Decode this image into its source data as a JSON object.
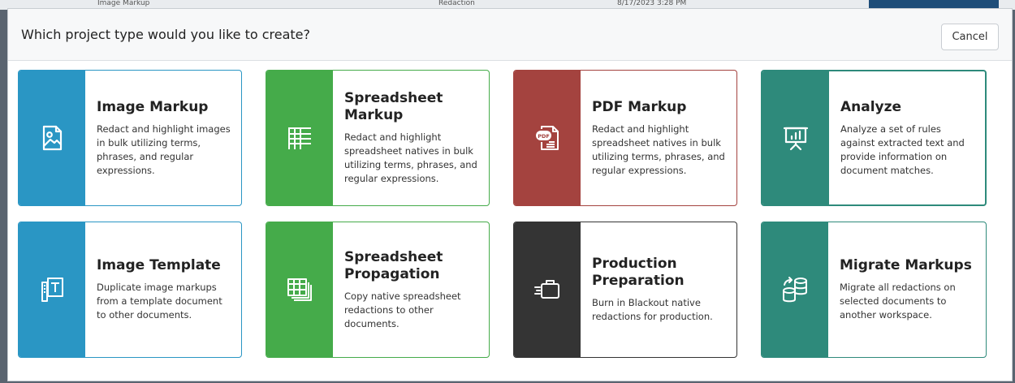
{
  "background": {
    "row_text_1": "Image Markup",
    "row_text_2": "Redaction",
    "row_text_3": "8/17/2023 3:28 PM"
  },
  "modal": {
    "title": "Which project type would you like to create?",
    "cancel_label": "Cancel"
  },
  "cards": [
    {
      "title": "Image Markup",
      "description": "Redact and highlight images in bulk utilizing terms, phrases, and regular expressions.",
      "icon": "image-icon",
      "color": "#2a96c4"
    },
    {
      "title": "Spreadsheet Markup",
      "description": "Redact and highlight spreadsheet natives in bulk utilizing terms, phrases, and regular expressions.",
      "icon": "spreadsheet-icon",
      "color": "#45ab4a"
    },
    {
      "title": "PDF Markup",
      "description": "Redact and highlight spreadsheet natives in bulk utilizing terms, phrases, and regular expressions.",
      "icon": "pdf-icon",
      "color": "#a4433f"
    },
    {
      "title": "Analyze",
      "description": "Analyze a set of rules against extracted text and provide information on document matches.",
      "icon": "presentation-chart-icon",
      "color": "#2e8a7b",
      "selected": true
    },
    {
      "title": "Image Template",
      "description": "Duplicate image markups from a template document to other documents.",
      "icon": "template-icon",
      "color": "#2a96c4"
    },
    {
      "title": "Spreadsheet Propagation",
      "description": "Copy native spreadsheet redactions to other documents.",
      "icon": "spreadsheet-stack-icon",
      "color": "#45ab4a"
    },
    {
      "title": "Production Preparation",
      "description": "Burn in Blackout native redactions for production.",
      "icon": "briefcase-icon",
      "color": "#343434"
    },
    {
      "title": "Migrate Markups",
      "description": "Migrate all redactions on selected documents to another workspace.",
      "icon": "database-migrate-icon",
      "color": "#2e8a7b"
    }
  ]
}
